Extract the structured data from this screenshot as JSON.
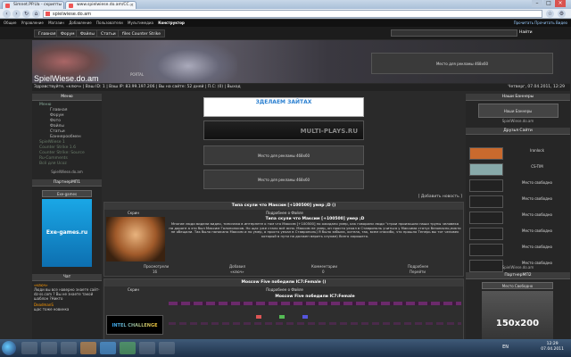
{
  "browser": {
    "tabs": [
      {
        "label": "Simnet.PP.Ua - скрипты"
      },
      {
        "label": "www.spielwiese.do.am/СС..."
      },
      {
        "label": "spielwiese.do.am"
      }
    ],
    "url": "spielwiese.do.am"
  },
  "site_top": {
    "items": [
      "Общие",
      "Управление",
      "Магазин",
      "Добавление",
      "Пользователи",
      "Мультимедиа",
      "Конструктор"
    ],
    "right_text": "Прочитать Прочитать Видео"
  },
  "nav": {
    "items": [
      "Главная",
      "Форум",
      "Файлы",
      "Статьи",
      "files Counter Strike"
    ],
    "search_button": "Найти"
  },
  "header": {
    "title": "SpielWiese.do.am",
    "portal": "PORTAL",
    "ad_text": "Место для рекламы 468x60"
  },
  "infobar": {
    "text": "Здравствуйте, «ключ» | Ваш ID: 1 | Ваш IP: 83.99.197.206 | Вы на сайте: 52 дней | П.С: (0) | Выход",
    "date": "Четверг, 07.04.2011, 12:29"
  },
  "left": {
    "menu_title": "Меню",
    "menu": [
      {
        "label": "Меню",
        "type": "head"
      },
      {
        "label": "Главная",
        "type": "sub"
      },
      {
        "label": "Форум",
        "type": "sub"
      },
      {
        "label": "Фото",
        "type": "sub"
      },
      {
        "label": "Файлы",
        "type": "sub"
      },
      {
        "label": "Статьи",
        "type": "sub"
      },
      {
        "label": "Баннерообмен",
        "type": "sub"
      },
      {
        "label": "SpielWiese 1",
        "type": "dim"
      },
      {
        "label": "Counter Strike 1.6",
        "type": "dim"
      },
      {
        "label": "Counter Strike: Source",
        "type": "dim"
      },
      {
        "label": "Ru-Comments",
        "type": "dim"
      },
      {
        "label": "Всё для Ucoz",
        "type": "dim"
      }
    ],
    "site": "SpielWiese.do.am",
    "partner_title": "ПартнерМП1",
    "partner_head": "Exe-games",
    "partner_banner": "Exe-games.ru",
    "chat_title": "Чат",
    "chat": [
      {
        "user": "«ключ»",
        "text": "Люди вы все наверно знаете сайт-dz-ss.com ? Вы не знаете такой шаблон ?Никто"
      },
      {
        "user": "DeadmanS",
        "text": "щас тоже новинка"
      }
    ]
  },
  "center": {
    "banner1": "ЗДЕЛАЕМ ЗАЙТАХ",
    "banner2": "MULTI-PLAYS.RU",
    "ad1": "Место для рекламы 468x60",
    "ad2": "Место для рекламы 468x60",
    "add_news": "[ Добавить новость ]",
    "news": [
      {
        "title": "Типа скули что Максим [+100500] умер ;D ()",
        "more": "Подробнее о Файле",
        "screen_label": "Скрин",
        "heading": "Типа скули что Максим [+100500] умер ;D",
        "body": "Многие люди видели видео, типичная в интернете о том что Максим [+100500] по ожидано умер, как говорили люди \"строи произошли наши трупы человека на дороге а это был Максим Голополосов. Но щас уже стало всё ясно. Максим не умер, он просто уехал в Ставрополь учиться у Максима статус безопасно,никто не обещали. Так было написано Максим и по умер, а просто уехал в Ставрополь) Я было забыла, хотела, так, всем спасибо, что прошло Теперь вы тот человек который в пути на должен верить слухам) Всего хорошего.",
        "stats_labels": [
          "Просмотрели",
          "Добавил",
          "Комментарии",
          "Подробнее"
        ],
        "stats_values": [
          "16",
          "«ключ»",
          "0",
          "Перейти"
        ]
      },
      {
        "title": "Moscow Five победили IC7:Female ()",
        "more": "Подробнее о Файле",
        "screen_label": "Скрин",
        "heading": "Moscow Five победили IC7:Female",
        "image_text": "INTEL CHALLENGE"
      }
    ]
  },
  "right": {
    "banners_title": "Наши Баннеры",
    "banner_caption": "Наши Баннеры",
    "site": "SpielWiese.do.am",
    "friends_title": "Друзья Сайти",
    "friends": [
      {
        "label": "Ironlock"
      },
      {
        "label": "CS-TIM"
      },
      {
        "label": "Место свободно"
      },
      {
        "label": "Место свободно"
      },
      {
        "label": "Место свободно"
      },
      {
        "label": "Место свободно"
      },
      {
        "label": "Место свободно"
      },
      {
        "label": "Место свободно"
      }
    ],
    "site2": "SpielWiese.do.am",
    "partner_title": "ПартнерМП2",
    "partner_head": "Место Свободно",
    "partner_size": "150x200"
  },
  "taskbar": {
    "lang": "EN",
    "time": "12:29",
    "date": "07.04.2011"
  }
}
